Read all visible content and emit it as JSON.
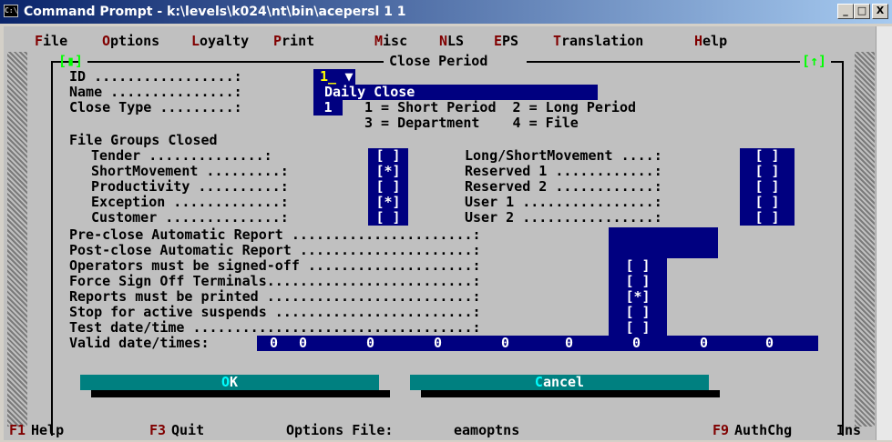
{
  "window": {
    "title": "Command Prompt - k:\\levels\\k024\\nt\\bin\\acepersl 1 1",
    "icon_label": "C:\\",
    "minimize": "_",
    "maximize": "□",
    "close": "X"
  },
  "menu": [
    {
      "hot": "F",
      "rest": "ile"
    },
    {
      "hot": "O",
      "rest": "ptions"
    },
    {
      "hot": "L",
      "rest": "oyalty"
    },
    {
      "hot": "P",
      "rest": "rint"
    },
    {
      "hot": "M",
      "rest": "isc"
    },
    {
      "hot": "N",
      "rest": "LS"
    },
    {
      "hot": "E",
      "rest": "PS"
    },
    {
      "hot": "T",
      "rest": "ranslation"
    },
    {
      "hot": "H",
      "rest": "elp"
    }
  ],
  "frame": {
    "title": "Close Period",
    "left_marker": "[▮]",
    "right_marker": "[↑]"
  },
  "fields": {
    "id_label": "ID .................:",
    "id_value": "1_",
    "id_dropdown": "▼",
    "name_label": "Name ...............:",
    "name_value": "Daily Close",
    "close_type_label": "Close Type .........:",
    "close_type_value": "1",
    "close_type_opt1": "1 = Short Period  2 = Long Period",
    "close_type_opt2": "3 = Department    4 = File"
  },
  "file_groups": {
    "heading": "File Groups Closed",
    "left": [
      {
        "label": "Tender ..............:",
        "value": "[ ]"
      },
      {
        "label": "ShortMovement .........:",
        "value": "[*]"
      },
      {
        "label": "Productivity ..........:",
        "value": "[ ]"
      },
      {
        "label": "Exception .............:",
        "value": "[*]"
      },
      {
        "label": "Customer ..............:",
        "value": "[ ]"
      }
    ],
    "right": [
      {
        "label": "Long/ShortMovement ....:",
        "value": "[ ]"
      },
      {
        "label": "Reserved 1 ............:",
        "value": "[ ]"
      },
      {
        "label": "Reserved 2 ............:",
        "value": "[ ]"
      },
      {
        "label": "User 1 ................:",
        "value": "[ ]"
      },
      {
        "label": "User 2 ................:",
        "value": "[ ]"
      }
    ]
  },
  "options": [
    {
      "label": "Pre-close Automatic Report ......................:",
      "value": ""
    },
    {
      "label": "Post-close Automatic Report .....................:",
      "value": ""
    },
    {
      "label": "Operators must be signed-off ....................:",
      "value": "[ ]"
    },
    {
      "label": "Force Sign Off Terminals.........................:",
      "value": "[ ]"
    },
    {
      "label": "Reports must be printed .........................:",
      "value": "[*]"
    },
    {
      "label": "Stop for active suspends ........................:",
      "value": "[ ]"
    },
    {
      "label": "Test date/time ..................................:",
      "value": "[ ]"
    }
  ],
  "valid_datetimes": {
    "label": "Valid date/times:",
    "values": [
      "0",
      "0",
      "0",
      "0",
      "0",
      "0",
      "0",
      "0",
      "0",
      "0"
    ]
  },
  "buttons": {
    "ok_hot": "O",
    "ok_rest": "K",
    "cancel_hot": "C",
    "cancel_rest": "ancel"
  },
  "status": {
    "f1_key": "F1",
    "f1_label": "Help",
    "f3_key": "F3",
    "f3_label": "Quit",
    "options_file_label": "Options File:",
    "options_file_value": "eamoptns",
    "f9_key": "F9",
    "f9_label": "AuthChg",
    "ins": "Ins"
  }
}
